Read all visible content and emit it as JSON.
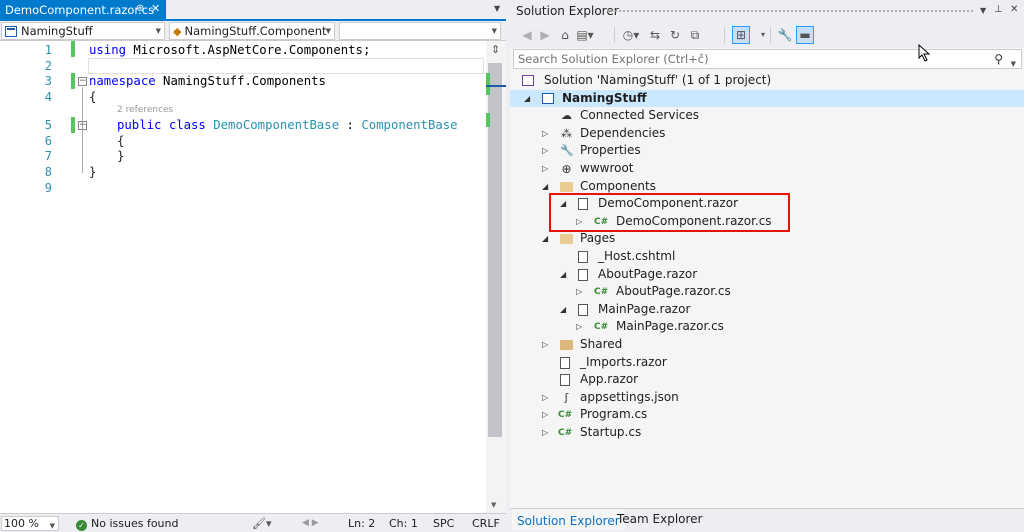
{
  "editor": {
    "tab": {
      "title": "DemoComponent.razor.cs",
      "pin": "⊕",
      "close": "✕"
    },
    "nav": {
      "project": "NamingStuff",
      "class": "NamingStuff.Component",
      "member": ""
    },
    "lines": [
      "1",
      "2",
      "3",
      "4",
      "5",
      "6",
      "7",
      "8",
      "9"
    ],
    "code": {
      "l1_kw": "using",
      "l1_rest": " Microsoft.AspNetCore.Components;",
      "l3_kw": "namespace",
      "l3_rest": " NamingStuff.Components",
      "l4": "{",
      "codelens": "2 references",
      "l5_kw": "public class",
      "l5_type": "DemoComponentBase",
      "l5_colon": " : ",
      "l5_base": "ComponentBase",
      "l6": "{",
      "l7": "}",
      "l8": "}"
    },
    "status": {
      "zoom": "100 %",
      "issues": "No issues found",
      "ln": "Ln: 2",
      "ch": "Ch: 1",
      "spc": "SPC",
      "crlf": "CRLF"
    }
  },
  "solution_explorer": {
    "title": "Solution Explorer",
    "search_placeholder": "Search Solution Explorer (Ctrl+č)",
    "tree": [
      {
        "label": "Solution 'NamingStuff' (1 of 1 project)"
      },
      {
        "label": "NamingStuff"
      },
      {
        "label": "Connected Services"
      },
      {
        "label": "Dependencies"
      },
      {
        "label": "Properties"
      },
      {
        "label": "wwwroot"
      },
      {
        "label": "Components"
      },
      {
        "label": "DemoComponent.razor"
      },
      {
        "label": "DemoComponent.razor.cs"
      },
      {
        "label": "Pages"
      },
      {
        "label": "_Host.cshtml"
      },
      {
        "label": "AboutPage.razor"
      },
      {
        "label": "AboutPage.razor.cs"
      },
      {
        "label": "MainPage.razor"
      },
      {
        "label": "MainPage.razor.cs"
      },
      {
        "label": "Shared"
      },
      {
        "label": "_Imports.razor"
      },
      {
        "label": "App.razor"
      },
      {
        "label": "appsettings.json"
      },
      {
        "label": "Program.cs"
      },
      {
        "label": "Startup.cs"
      }
    ],
    "bottom_tabs": [
      "Solution Explorer",
      "Team Explorer"
    ],
    "highlight_color": "#e51400"
  }
}
